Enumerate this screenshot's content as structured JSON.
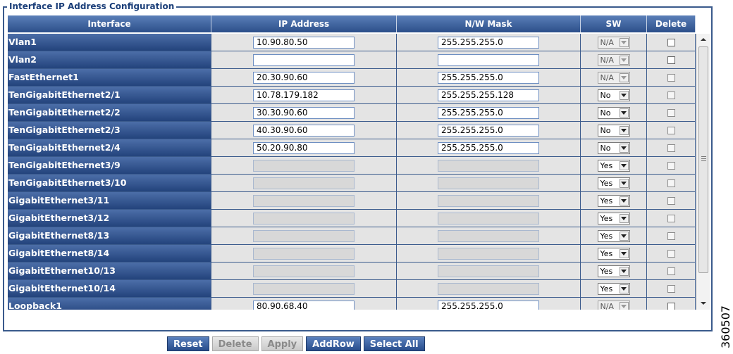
{
  "panel": {
    "title": "Interface IP Address Configuration"
  },
  "columns": {
    "interface": "Interface",
    "ip": "IP Address",
    "mask": "N/W Mask",
    "sw": "SW",
    "delete": "Delete"
  },
  "rows": [
    {
      "interface": "Vlan1",
      "ip": "10.90.80.50",
      "mask": "255.255.255.0",
      "sw": "N/A"
    },
    {
      "interface": "Vlan2",
      "ip": "",
      "mask": "",
      "sw": "N/A"
    },
    {
      "interface": "FastEthernet1",
      "ip": "20.30.90.60",
      "mask": "255.255.255.0",
      "sw": "N/A"
    },
    {
      "interface": "TenGigabitEthernet2/1",
      "ip": "10.78.179.182",
      "mask": "255.255.255.128",
      "sw": "No"
    },
    {
      "interface": "TenGigabitEthernet2/2",
      "ip": "30.30.90.60",
      "mask": "255.255.255.0",
      "sw": "No"
    },
    {
      "interface": "TenGigabitEthernet2/3",
      "ip": "40.30.90.60",
      "mask": "255.255.255.0",
      "sw": "No"
    },
    {
      "interface": "TenGigabitEthernet2/4",
      "ip": "50.20.90.80",
      "mask": "255.255.255.0",
      "sw": "No"
    },
    {
      "interface": "TenGigabitEthernet3/9",
      "ip": "",
      "mask": "",
      "sw": "Yes"
    },
    {
      "interface": "TenGigabitEthernet3/10",
      "ip": "",
      "mask": "",
      "sw": "Yes"
    },
    {
      "interface": "GigabitEthernet3/11",
      "ip": "",
      "mask": "",
      "sw": "Yes"
    },
    {
      "interface": "GigabitEthernet3/12",
      "ip": "",
      "mask": "",
      "sw": "Yes"
    },
    {
      "interface": "GigabitEthernet8/13",
      "ip": "",
      "mask": "",
      "sw": "Yes"
    },
    {
      "interface": "GigabitEthernet8/14",
      "ip": "",
      "mask": "",
      "sw": "Yes"
    },
    {
      "interface": "GigabitEthernet10/13",
      "ip": "",
      "mask": "",
      "sw": "Yes"
    },
    {
      "interface": "GigabitEthernet10/14",
      "ip": "",
      "mask": "",
      "sw": "Yes"
    },
    {
      "interface": "Loopback1",
      "ip": "80.90.68.40",
      "mask": "255.255.255.0",
      "sw": "N/A"
    }
  ],
  "buttons": {
    "reset": "Reset",
    "delete": "Delete",
    "apply": "Apply",
    "addrow": "AddRow",
    "select_all": "Select All"
  },
  "figure_number": "360507"
}
